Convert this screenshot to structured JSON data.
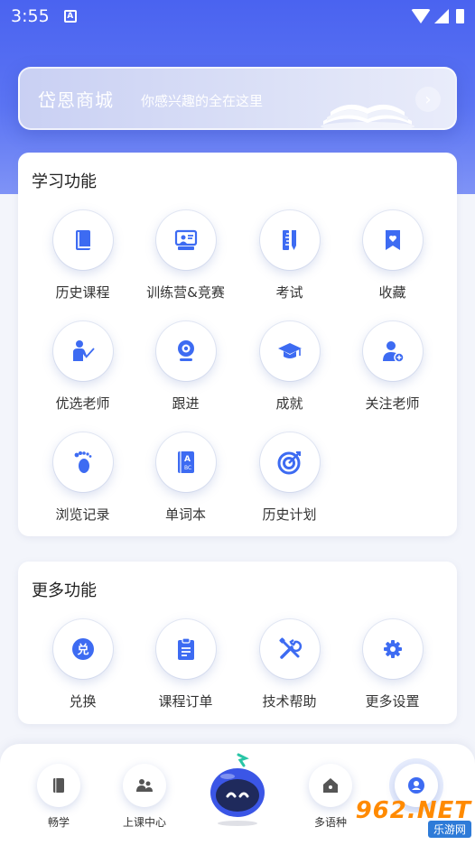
{
  "status_bar": {
    "time": "3:55",
    "notification_badge": "A"
  },
  "banner": {
    "title": "岱恩商城",
    "subtitle": "你感兴趣的全在这里",
    "arrow": "›"
  },
  "learning": {
    "title": "学习功能",
    "items": [
      {
        "label": "历史课程",
        "icon": "book-icon"
      },
      {
        "label": "训练营&竞赛",
        "icon": "presentation-icon"
      },
      {
        "label": "考试",
        "icon": "ruler-pencil-icon"
      },
      {
        "label": "收藏",
        "icon": "bookmark-heart-icon"
      },
      {
        "label": "优选老师",
        "icon": "teacher-icon"
      },
      {
        "label": "跟进",
        "icon": "webcam-icon"
      },
      {
        "label": "成就",
        "icon": "graduation-cap-icon"
      },
      {
        "label": "关注老师",
        "icon": "user-follow-icon"
      },
      {
        "label": "浏览记录",
        "icon": "footprint-icon"
      },
      {
        "label": "单词本",
        "icon": "vocabulary-book-icon"
      },
      {
        "label": "历史计划",
        "icon": "target-icon"
      }
    ]
  },
  "more": {
    "title": "更多功能",
    "items": [
      {
        "label": "兑换",
        "icon": "exchange-icon",
        "glyph": "兑"
      },
      {
        "label": "课程订单",
        "icon": "clipboard-icon"
      },
      {
        "label": "技术帮助",
        "icon": "tools-icon"
      },
      {
        "label": "更多设置",
        "icon": "gear-icon"
      }
    ]
  },
  "bottom_nav": {
    "items": [
      {
        "label": "畅学",
        "icon": "book-nav-icon"
      },
      {
        "label": "上课中心",
        "icon": "group-icon"
      },
      {
        "label": "",
        "icon": "robot-icon"
      },
      {
        "label": "多语种",
        "icon": "home-icon"
      },
      {
        "label": "",
        "icon": "profile-icon"
      }
    ]
  },
  "watermark": {
    "big": "962.NET",
    "small": "乐游网"
  },
  "colors": {
    "accent": "#3d6bf2",
    "header": "#4a63f0",
    "text": "#333333"
  }
}
